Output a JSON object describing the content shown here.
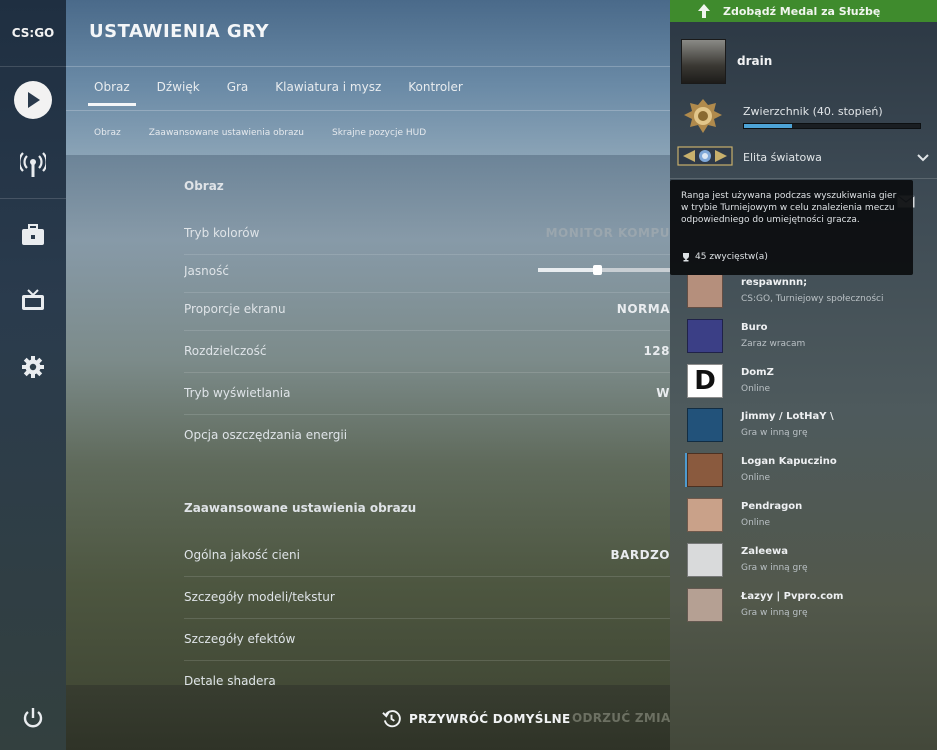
{
  "nav": {
    "logo": "CS:GO",
    "items": [
      {
        "name": "play",
        "icon": "play-icon"
      },
      {
        "name": "broadcast",
        "icon": "broadcast-icon"
      },
      {
        "name": "inventory",
        "icon": "briefcase-icon"
      },
      {
        "name": "watch",
        "icon": "tv-icon"
      },
      {
        "name": "settings",
        "icon": "gear-icon"
      },
      {
        "name": "power",
        "icon": "power-icon"
      }
    ]
  },
  "header": {
    "title": "USTAWIENIA GRY",
    "tabs": [
      "Obraz",
      "Dźwięk",
      "Gra",
      "Klawiatura i mysz",
      "Kontroler"
    ],
    "active_tab": "Obraz",
    "subtabs": [
      "Obraz",
      "Zaawansowane ustawienia obrazu",
      "Skrajne pozycje HUD"
    ]
  },
  "settings": {
    "section1": {
      "title": "Obraz",
      "rows": [
        {
          "label": "Tryb kolorów",
          "value": "MONITOR KOMPU"
        },
        {
          "label": "Jasność",
          "slider_fraction": 0.45
        },
        {
          "label": "Proporcje ekranu",
          "value": "NORMA"
        },
        {
          "label": "Rozdzielczość",
          "value": "128"
        },
        {
          "label": "Tryb wyświetlania",
          "value": "W"
        },
        {
          "label": "Opcja oszczędzania energii",
          "value": ""
        }
      ]
    },
    "section2": {
      "title": "Zaawansowane ustawienia obrazu",
      "rows": [
        {
          "label": "Ogólna jakość cieni",
          "value": "BARDZO"
        },
        {
          "label": "Szczegóły modeli/tekstur",
          "value": ""
        },
        {
          "label": "Szczegóły efektów",
          "value": ""
        },
        {
          "label": "Detale shadera",
          "value": ""
        }
      ]
    }
  },
  "footer": {
    "restore_label": "PRZYWRÓĆ DOMYŚLNE",
    "discard_label": "ODRZUĆ ZMIANY"
  },
  "panel": {
    "medal_banner": "Zdobądź Medal za Służbę",
    "profile": {
      "name": "drain"
    },
    "rank": {
      "title": "Zwierzchnik (40. stopień)",
      "xp_fraction": 0.27
    },
    "skill_group": "Elita światowa",
    "tooltip": {
      "text": "Ranga jest używana podczas wyszukiwania gier w trybie Turniejowym w celu znalezienia meczu odpowiedniego do umiejętności gracza.",
      "wins": "45 zwycięstw(a)"
    },
    "friends": [
      {
        "name": "respawnnn;",
        "status": "CS:GO, Turniejowy społeczności",
        "color": "#b58f7c"
      },
      {
        "name": "Buro",
        "status": "Zaraz wracam",
        "color": "#3b3f86"
      },
      {
        "name": "DomZ",
        "status": "Online",
        "color": "#ffffff"
      },
      {
        "name": "Jimmy / LotHaY \\",
        "status": "Gra w inną grę",
        "color": "#22527a"
      },
      {
        "name": "Logan Kapuczino",
        "status": "Online",
        "color": "#8a5a3e"
      },
      {
        "name": "Pendragon",
        "status": "Online",
        "color": "#c9a189"
      },
      {
        "name": "Zaleewa",
        "status": "Gra w inną grę",
        "color": "#d9dadb"
      },
      {
        "name": "Łazyy | Pvpro.com",
        "status": "Gra w inną grę",
        "color": "#b5a093"
      }
    ]
  }
}
